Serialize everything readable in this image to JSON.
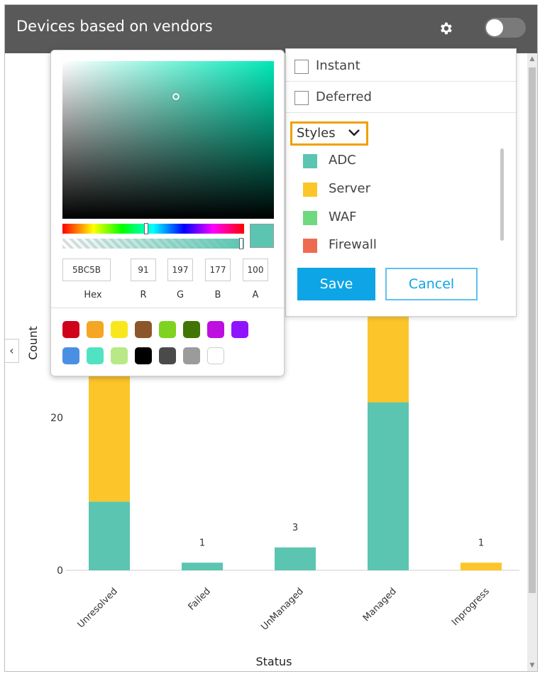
{
  "header": {
    "title": "Devices based on vendors",
    "settings_icon": "gear-icon",
    "toggle_state": "off"
  },
  "color_picker": {
    "hex": "5BC5B",
    "r": "91",
    "g": "197",
    "b": "177",
    "a": "100",
    "labels": {
      "hex": "Hex",
      "r": "R",
      "g": "G",
      "b": "B",
      "a": "A"
    },
    "current_color": "#5bc5b1",
    "presets": [
      "#d0021b",
      "#f5a623",
      "#f8e71c",
      "#8b572a",
      "#7ed321",
      "#417505",
      "#bd10e0",
      "#9013fe",
      "#4a90e2",
      "#50e3c2",
      "#b8e986",
      "#000000",
      "#4a4a4a",
      "#9b9b9b",
      "#ffffff"
    ]
  },
  "options": {
    "instant_label": "Instant",
    "deferred_label": "Deferred",
    "styles_label": "Styles",
    "legend": [
      {
        "label": "ADC",
        "color": "#5bc5b1"
      },
      {
        "label": "Server",
        "color": "#fcc52a"
      },
      {
        "label": "WAF",
        "color": "#70d87e"
      },
      {
        "label": "Firewall",
        "color": "#ee6b50"
      }
    ],
    "save_label": "Save",
    "cancel_label": "Cancel"
  },
  "chart_data": {
    "type": "bar",
    "stacked": true,
    "categories": [
      "Unresolved",
      "Failed",
      "UnManaged",
      "Managed",
      "Inprogress"
    ],
    "series": [
      {
        "name": "ADC",
        "color": "#5bc5b1",
        "values": [
          9,
          1,
          3,
          22,
          0
        ]
      },
      {
        "name": "Server",
        "color": "#fcc52a",
        "values": [
          null,
          0,
          0,
          null,
          1
        ]
      }
    ],
    "data_labels": [
      "",
      "1",
      "3",
      "",
      "1"
    ],
    "xlabel": "Status",
    "ylabel": "Count",
    "yticks": [
      0,
      20
    ],
    "ylim": [
      0,
      33
    ],
    "grid": false
  }
}
